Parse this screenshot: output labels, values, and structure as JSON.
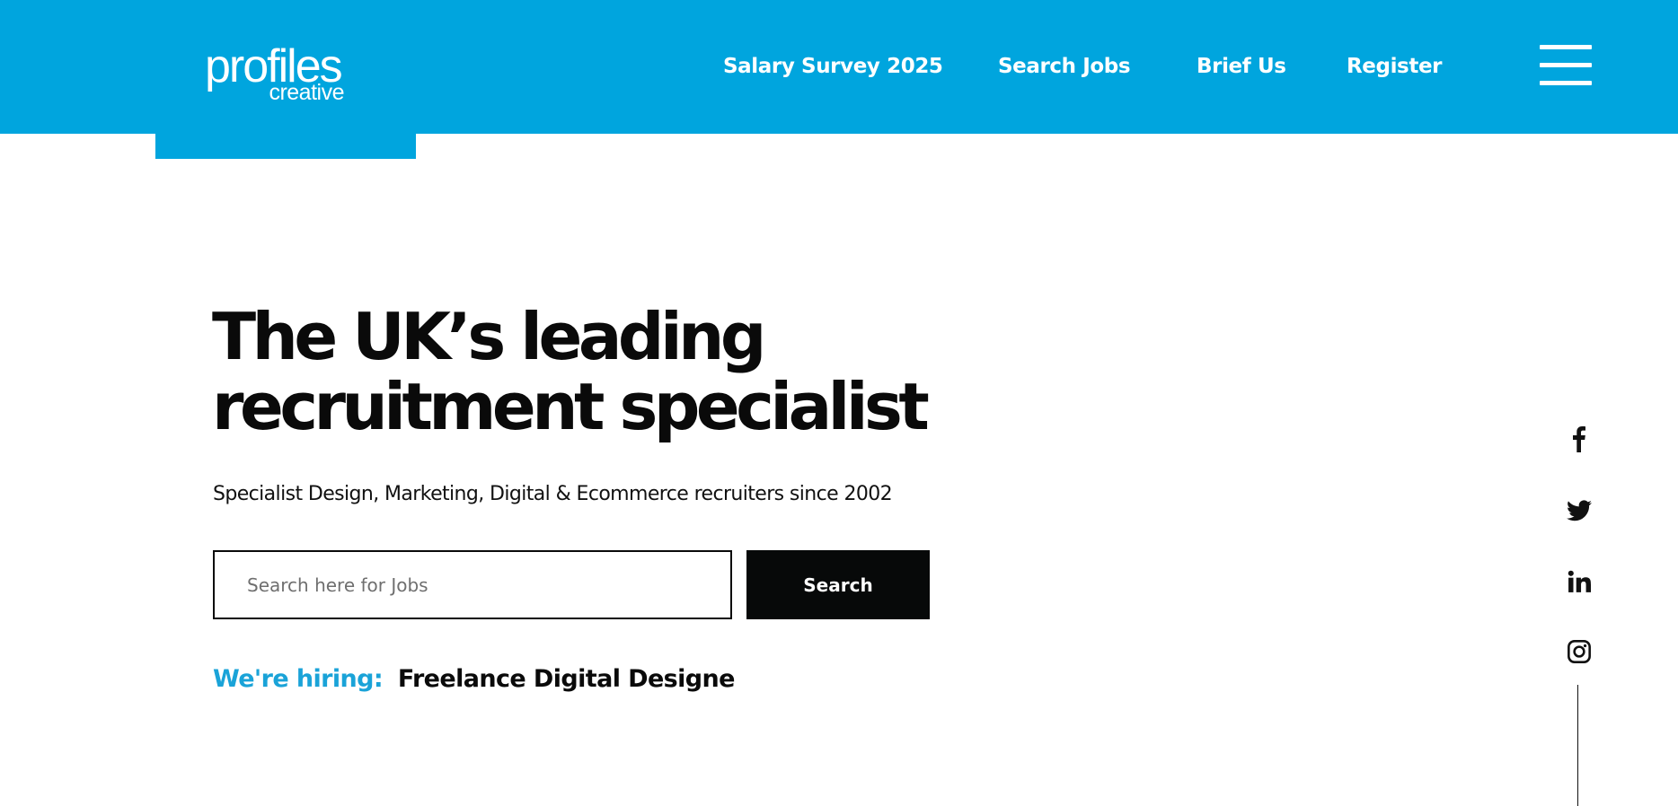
{
  "brand": {
    "logo_main": "profiles",
    "logo_sub": "creative",
    "primary_color": "#00a5de",
    "dark_color": "#070909",
    "accent_text_color": "#1aa3d8"
  },
  "header": {
    "nav": [
      {
        "label": "Salary Survey 2025"
      },
      {
        "label": "Search Jobs"
      },
      {
        "label": "Brief Us"
      },
      {
        "label": "Register"
      }
    ],
    "menu_icon": "hamburger-menu-icon"
  },
  "hero": {
    "headline_line1": "The UK’s leading",
    "headline_line2": "recruitment specialist",
    "subheadline": "Specialist Design, Marketing, Digital & Ecommerce recruiters since 2002",
    "search": {
      "placeholder": "Search here for Jobs",
      "value": "",
      "button_label": "Search"
    },
    "hiring": {
      "label": "We're hiring:",
      "role": "Freelance Digital Designe"
    }
  },
  "social": [
    {
      "icon": "facebook-icon"
    },
    {
      "icon": "twitter-icon"
    },
    {
      "icon": "linkedin-icon"
    },
    {
      "icon": "instagram-icon"
    }
  ]
}
